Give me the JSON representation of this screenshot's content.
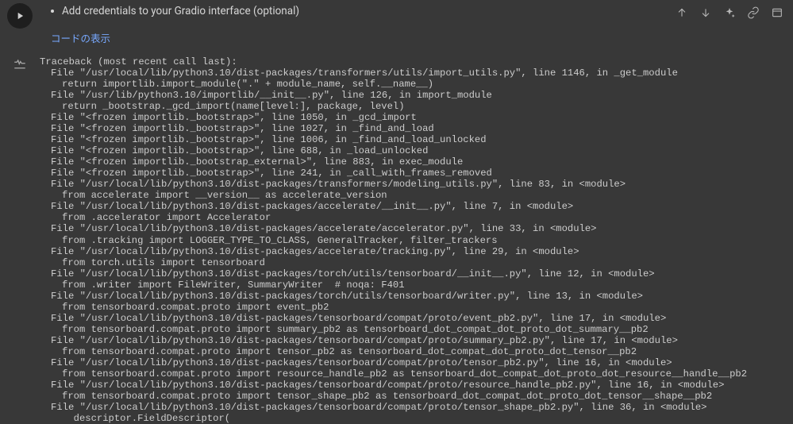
{
  "cell": {
    "bullet_text": "Add credentials to your Gradio interface (optional)",
    "show_code_label": "コードの表示"
  },
  "traceback": {
    "header": "Traceback (most recent call last):",
    "frames": [
      {
        "loc": "File \"/usr/local/lib/python3.10/dist-packages/transformers/utils/import_utils.py\", line 1146, in _get_module",
        "code": "return importlib.import_module(\".\" + module_name, self.__name__)"
      },
      {
        "loc": "File \"/usr/lib/python3.10/importlib/__init__.py\", line 126, in import_module",
        "code": "return _bootstrap._gcd_import(name[level:], package, level)"
      },
      {
        "loc": "File \"<frozen importlib._bootstrap>\", line 1050, in _gcd_import",
        "code": null
      },
      {
        "loc": "File \"<frozen importlib._bootstrap>\", line 1027, in _find_and_load",
        "code": null
      },
      {
        "loc": "File \"<frozen importlib._bootstrap>\", line 1006, in _find_and_load_unlocked",
        "code": null
      },
      {
        "loc": "File \"<frozen importlib._bootstrap>\", line 688, in _load_unlocked",
        "code": null
      },
      {
        "loc": "File \"<frozen importlib._bootstrap_external>\", line 883, in exec_module",
        "code": null
      },
      {
        "loc": "File \"<frozen importlib._bootstrap>\", line 241, in _call_with_frames_removed",
        "code": null
      },
      {
        "loc": "File \"/usr/local/lib/python3.10/dist-packages/transformers/modeling_utils.py\", line 83, in <module>",
        "code": "from accelerate import __version__ as accelerate_version"
      },
      {
        "loc": "File \"/usr/local/lib/python3.10/dist-packages/accelerate/__init__.py\", line 7, in <module>",
        "code": "from .accelerator import Accelerator"
      },
      {
        "loc": "File \"/usr/local/lib/python3.10/dist-packages/accelerate/accelerator.py\", line 33, in <module>",
        "code": "from .tracking import LOGGER_TYPE_TO_CLASS, GeneralTracker, filter_trackers"
      },
      {
        "loc": "File \"/usr/local/lib/python3.10/dist-packages/accelerate/tracking.py\", line 29, in <module>",
        "code": "from torch.utils import tensorboard"
      },
      {
        "loc": "File \"/usr/local/lib/python3.10/dist-packages/torch/utils/tensorboard/__init__.py\", line 12, in <module>",
        "code": "from .writer import FileWriter, SummaryWriter  # noqa: F401"
      },
      {
        "loc": "File \"/usr/local/lib/python3.10/dist-packages/torch/utils/tensorboard/writer.py\", line 13, in <module>",
        "code": "from tensorboard.compat.proto import event_pb2"
      },
      {
        "loc": "File \"/usr/local/lib/python3.10/dist-packages/tensorboard/compat/proto/event_pb2.py\", line 17, in <module>",
        "code": "from tensorboard.compat.proto import summary_pb2 as tensorboard_dot_compat_dot_proto_dot_summary__pb2"
      },
      {
        "loc": "File \"/usr/local/lib/python3.10/dist-packages/tensorboard/compat/proto/summary_pb2.py\", line 17, in <module>",
        "code": "from tensorboard.compat.proto import tensor_pb2 as tensorboard_dot_compat_dot_proto_dot_tensor__pb2"
      },
      {
        "loc": "File \"/usr/local/lib/python3.10/dist-packages/tensorboard/compat/proto/tensor_pb2.py\", line 16, in <module>",
        "code": "from tensorboard.compat.proto import resource_handle_pb2 as tensorboard_dot_compat_dot_proto_dot_resource__handle__pb2"
      },
      {
        "loc": "File \"/usr/local/lib/python3.10/dist-packages/tensorboard/compat/proto/resource_handle_pb2.py\", line 16, in <module>",
        "code": "from tensorboard.compat.proto import tensor_shape_pb2 as tensorboard_dot_compat_dot_proto_dot_tensor__shape__pb2"
      },
      {
        "loc": "File \"/usr/local/lib/python3.10/dist-packages/tensorboard/compat/proto/tensor_shape_pb2.py\", line 36, in <module>",
        "code": "  descriptor.FieldDescriptor("
      }
    ]
  }
}
